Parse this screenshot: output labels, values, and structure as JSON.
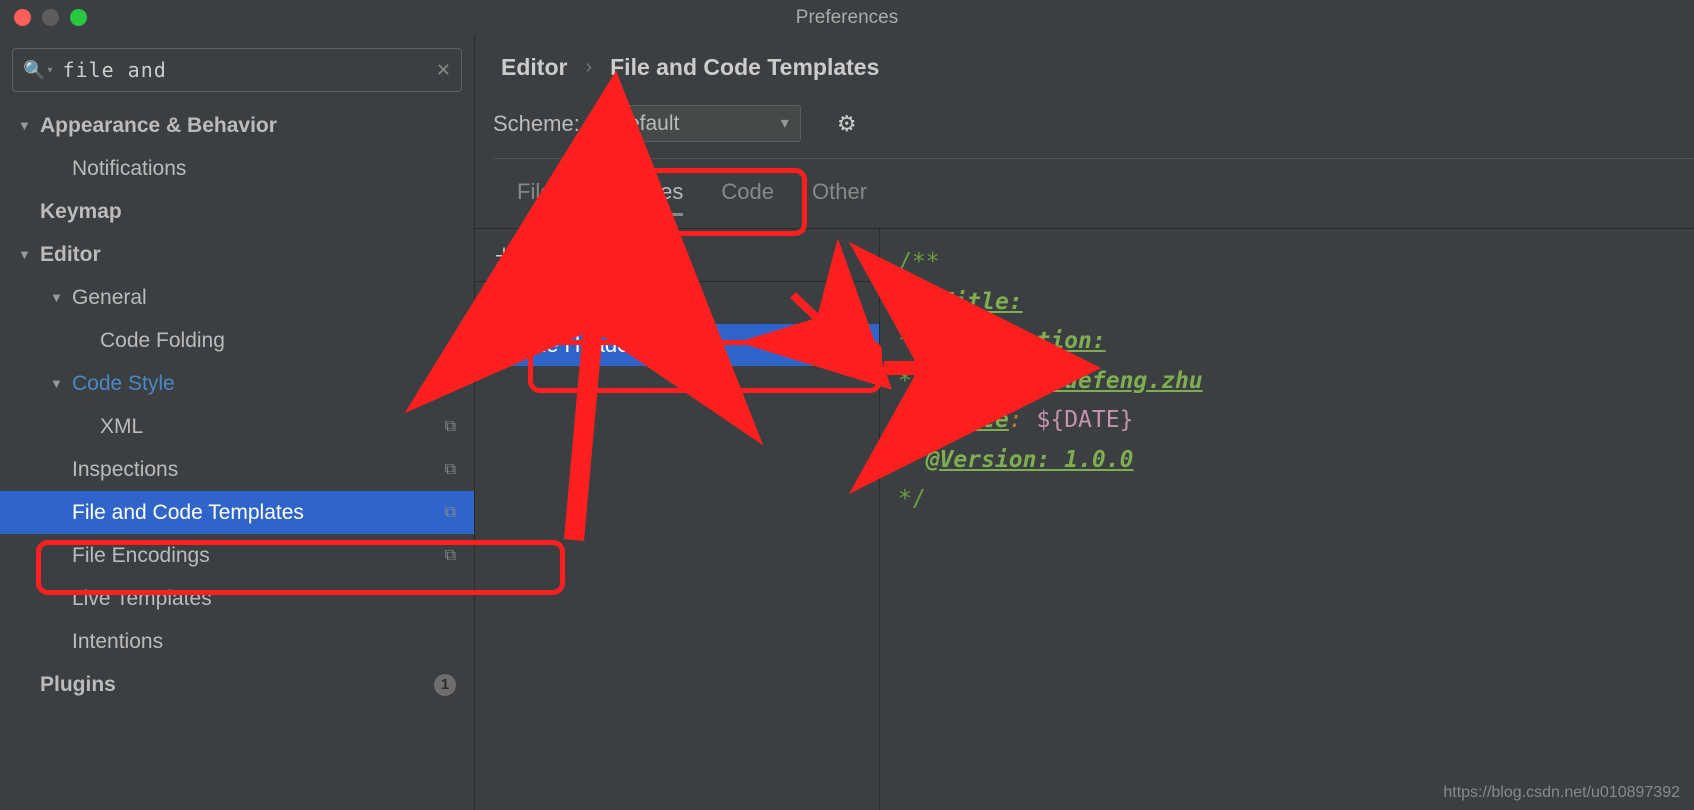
{
  "titlebar": {
    "title": "Preferences"
  },
  "search": {
    "value": "file and",
    "placeholder": ""
  },
  "sidebar": {
    "items": [
      {
        "label": "Appearance & Behavior",
        "depth": 0,
        "arrow": "▼",
        "bold": true
      },
      {
        "label": "Notifications",
        "depth": 1
      },
      {
        "label": "Keymap",
        "depth": 0,
        "bold": true
      },
      {
        "label": "Editor",
        "depth": 0,
        "arrow": "▼",
        "bold": true
      },
      {
        "label": "General",
        "depth": 1,
        "arrow": "▼"
      },
      {
        "label": "Code Folding",
        "depth": 2
      },
      {
        "label": "Code Style",
        "depth": 1,
        "arrow": "▼",
        "blue": true,
        "copy": true
      },
      {
        "label": "XML",
        "depth": 2,
        "copy": true
      },
      {
        "label": "Inspections",
        "depth": 1,
        "copy": true
      },
      {
        "label": "File and Code Templates",
        "depth": 1,
        "copy": true,
        "sel": true
      },
      {
        "label": "File Encodings",
        "depth": 1,
        "copy": true
      },
      {
        "label": "Live Templates",
        "depth": 1
      },
      {
        "label": "Intentions",
        "depth": 1
      },
      {
        "label": "Plugins",
        "depth": 0,
        "bold": true,
        "badge": "1"
      }
    ]
  },
  "crumb": {
    "root": "Editor",
    "page": "File and Code Templates"
  },
  "scheme": {
    "label": "Scheme:",
    "value": "Default"
  },
  "tabs": [
    "Files",
    "Includes",
    "Code",
    "Other"
  ],
  "activeTab": 1,
  "toolbar": {
    "add": "＋",
    "remove": "－",
    "copy": "⧉",
    "undo": "↶"
  },
  "list": [
    {
      "label": "File Header"
    },
    {
      "label": "File Header",
      "sel": true
    }
  ],
  "code": {
    "l0": "/**",
    "title": "@Title",
    "title_tail": ": ",
    "desc": "@Description",
    "desc_tail": ": ",
    "auth": "@Author",
    "auth_val": ": xuefeng.zhu",
    "since": "@Since",
    "since_sep": ": ",
    "since_var": "${DATE}",
    "ver": "@Version",
    "ver_val": ": 1.0.0",
    "end": "*/"
  },
  "watermark": "https://blog.csdn.net/u010897392"
}
